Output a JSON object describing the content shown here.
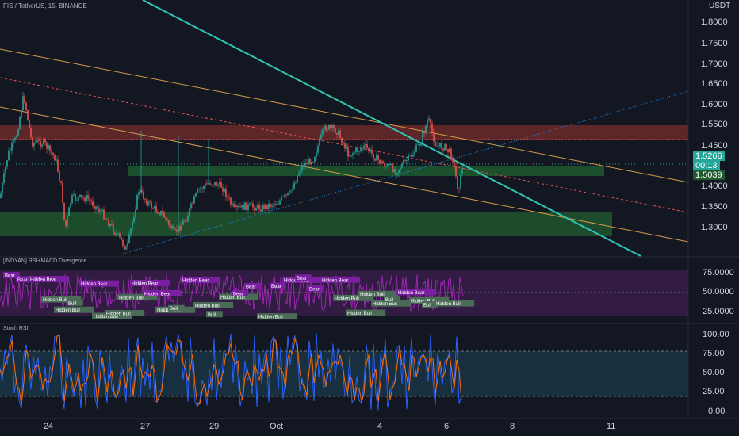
{
  "symbol_line": "FIS / TetherUS, 15, BINANCE",
  "price_axis": {
    "unit": "USDT",
    "ticks": [
      "1.8000",
      "1.7500",
      "1.7000",
      "1.6500",
      "1.6000",
      "1.5500",
      "1.4500",
      "1.4000",
      "1.3500",
      "1.3000"
    ],
    "current_price": "1.5266",
    "countdown": "00:13",
    "line_price": "1.5039"
  },
  "rsi_pane": {
    "title": "[INDYAN] RSI+MACD Divergence",
    "ticks": [
      "75.0000",
      "50.0000",
      "25.0000"
    ],
    "labels": [
      "Bear",
      "Bear",
      "Hidden Bear",
      "Hidden Bull",
      "Hidden Bull",
      "Bull",
      "Hidden Bear",
      "Hidden Bull",
      "Hidden Bull",
      "Hidden Bull",
      "Hidden Bear",
      "Hidden Bear",
      "Hidden Bull",
      "Bull",
      "Hidden Bear",
      "Hidden Bull",
      "Bull",
      "Hidden Bull",
      "Bear",
      "Bear",
      "Hidden Bull",
      "Bear",
      "Hidden Bear",
      "Bear",
      "Bear",
      "Hidden Bear",
      "Hidden Bull",
      "Hidden Bull",
      "Hidden Bull",
      "Hidden Bull",
      "Bull",
      "Hidden Bear",
      "Hidden Bull",
      "Bull",
      "Hidden Bull"
    ]
  },
  "stoch_pane": {
    "title": "Stoch RSI",
    "ticks": [
      "100.00",
      "75.00",
      "50.00",
      "25.00",
      "0.00"
    ]
  },
  "time_axis": {
    "ticks": [
      "24",
      "27",
      "29",
      "Oct",
      "4",
      "6",
      "8",
      "11"
    ]
  },
  "colors": {
    "background": "#131722",
    "up": "#26a69a",
    "down": "#ef5350",
    "trendline": "#2ec4b6",
    "resistance_zone": "#7a2a2a",
    "support_zone": "#1f4d2b",
    "orange_line": "#d49a4a",
    "rsi_line": "#9c27b0",
    "stoch_k": "#2962ff",
    "stoch_d": "#ff6d00"
  }
}
